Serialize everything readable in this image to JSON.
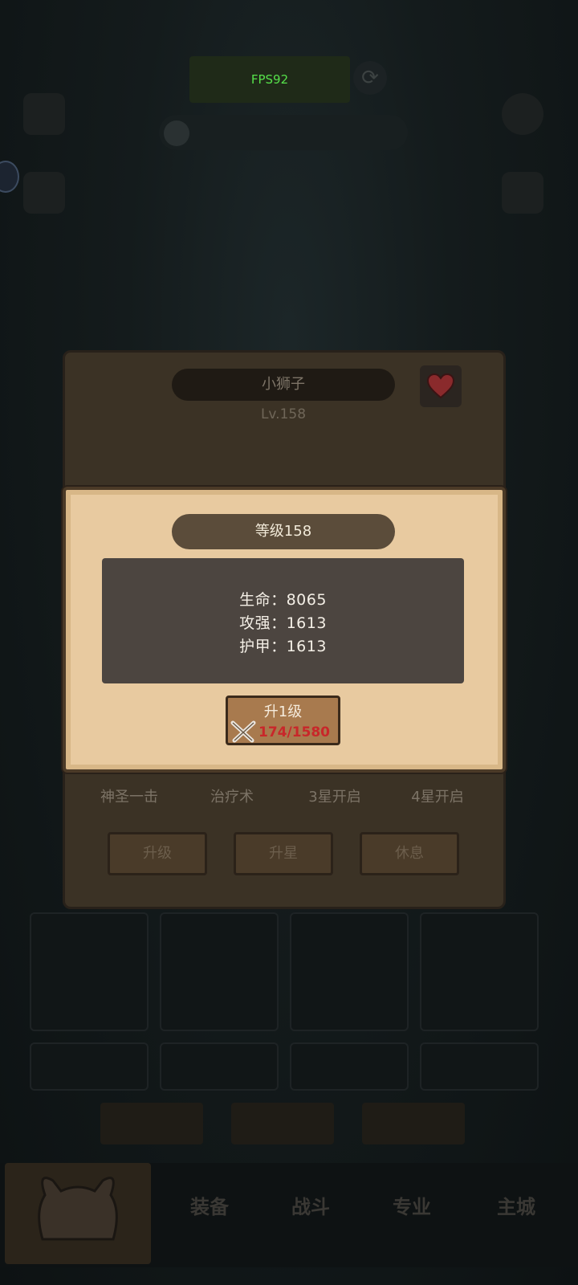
{
  "hud": {
    "fps": "FPS92"
  },
  "character": {
    "name": "小狮子",
    "level": "Lv.158",
    "skills": [
      "神圣一击",
      "治疗术",
      "3星开启",
      "4星开启"
    ],
    "buttons": {
      "upgrade": "升级",
      "star_up": "升星",
      "rest": "休息"
    }
  },
  "navigation": {
    "items": [
      "装备",
      "战斗",
      "专业",
      "主城"
    ]
  },
  "level_popup": {
    "title": "等级158",
    "stats": {
      "hp": "生命：8065",
      "attack": "攻强：1613",
      "armor": "护甲：1613"
    },
    "upgrade_button": {
      "label": "升1级",
      "cost": "174/1580"
    }
  },
  "colors": {
    "popup_bg": "#e8caa0",
    "stats_bg": "#4c4540",
    "cost_red": "#c8272a",
    "fps_green": "#56e04a"
  }
}
